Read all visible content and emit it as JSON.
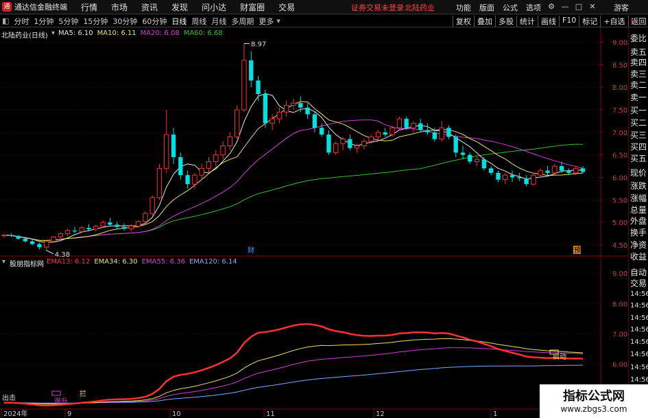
{
  "app": {
    "name": "通达信金融终端",
    "menus": [
      "行情",
      "市场",
      "资讯",
      "发现",
      "问小达",
      "财富圈",
      "交易"
    ],
    "login_status": "证券交易未登录",
    "stock_name": "北陆药业",
    "right_menus": [
      "功能",
      "版面",
      "公式",
      "选项"
    ],
    "guest": "游客",
    "layout_mark": "L"
  },
  "toolbar": {
    "periods": [
      "分时",
      "1分钟",
      "5分钟",
      "15分钟",
      "30分钟",
      "60分钟",
      "日线",
      "周线",
      "月线",
      "多周期",
      "更多"
    ],
    "active_period": "日线",
    "right_buttons": [
      "复权",
      "叠加",
      "多股",
      "统计",
      "画线",
      "F10",
      "标记",
      "+自选",
      "返回"
    ]
  },
  "main_chart": {
    "stock_title": "北陆药业(日线)",
    "ma_legend": [
      {
        "label": "MA5: 6.10",
        "color": "#e6e6e6"
      },
      {
        "label": "MA10: 6.11",
        "color": "#f0e060"
      },
      {
        "label": "MA20: 6.08",
        "color": "#d040d0"
      },
      {
        "label": "MA60: 6.68",
        "color": "#30c030"
      }
    ],
    "y_ticks": [
      "9.00",
      "8.50",
      "8.00",
      "7.50",
      "7.00",
      "6.50",
      "6.00",
      "5.50",
      "5.00",
      "4.50"
    ],
    "high_label": "8.97",
    "low_label": "4.38",
    "marker_cai": "财",
    "marker_yu": "预"
  },
  "indicator": {
    "name": "股朋指标网",
    "legend": [
      {
        "label": "EMA13: 6.12",
        "color": "#ff3030"
      },
      {
        "label": "EMA34: 6.30",
        "color": "#f0e060"
      },
      {
        "label": "EMA55: 6.36",
        "color": "#d040d0"
      },
      {
        "label": "EMA120: 6.14",
        "color": "#80a8ff"
      }
    ],
    "y_ticks": [
      "9.00",
      "8.00",
      "7.00",
      "6.00"
    ],
    "signals": {
      "chu": "出击",
      "qi": "启动",
      "zhang": "涨升",
      "lan": "拦"
    }
  },
  "time_axis": [
    "2024年",
    "9",
    "10",
    "11",
    "12",
    "1"
  ],
  "side_panel": {
    "labels": [
      "委比",
      "卖五",
      "卖四",
      "卖三",
      "卖二",
      "卖一",
      "买一",
      "买二",
      "买三",
      "买四",
      "买五",
      "现价",
      "涨跌",
      "涨幅",
      "总量",
      "外盘",
      "换手",
      "净资",
      "收益",
      "自动",
      "交易"
    ],
    "times": [
      "14:56",
      "14:56",
      "14:56",
      "14:56",
      "14:56",
      "14:56",
      "14:56",
      "14:56"
    ]
  },
  "watermark": {
    "title": "指标公式网",
    "url": "www.zbgs3.com"
  },
  "colors": {
    "up": "#ff3030",
    "down": "#00e0e0",
    "grid": "#4a0000",
    "axis": "#900000"
  },
  "chart_data": {
    "type": "candlestick",
    "title": "北陆药业(日线)",
    "ylim": [
      4.3,
      9.1
    ],
    "ohlc": [
      [
        4.7,
        4.74,
        4.66,
        4.72
      ],
      [
        4.72,
        4.76,
        4.68,
        4.7
      ],
      [
        4.7,
        4.72,
        4.62,
        4.64
      ],
      [
        4.64,
        4.68,
        4.55,
        4.58
      ],
      [
        4.58,
        4.62,
        4.5,
        4.52
      ],
      [
        4.52,
        4.55,
        4.4,
        4.45
      ],
      [
        4.45,
        4.6,
        4.38,
        4.58
      ],
      [
        4.58,
        4.7,
        4.55,
        4.68
      ],
      [
        4.68,
        4.78,
        4.62,
        4.75
      ],
      [
        4.75,
        4.86,
        4.7,
        4.82
      ],
      [
        4.82,
        4.9,
        4.76,
        4.8
      ],
      [
        4.8,
        4.92,
        4.76,
        4.88
      ],
      [
        4.88,
        4.96,
        4.8,
        4.85
      ],
      [
        4.85,
        4.95,
        4.8,
        4.92
      ],
      [
        4.92,
        5.05,
        4.88,
        5.0
      ],
      [
        5.0,
        5.1,
        4.92,
        4.95
      ],
      [
        4.95,
        5.02,
        4.85,
        4.9
      ],
      [
        4.9,
        4.98,
        4.82,
        4.86
      ],
      [
        4.86,
        4.96,
        4.8,
        4.92
      ],
      [
        4.92,
        5.05,
        4.88,
        5.02
      ],
      [
        5.02,
        5.25,
        4.98,
        5.2
      ],
      [
        5.2,
        5.6,
        5.15,
        5.55
      ],
      [
        5.55,
        6.3,
        5.5,
        6.2
      ],
      [
        6.2,
        7.5,
        6.1,
        6.95
      ],
      [
        6.95,
        7.1,
        6.3,
        6.45
      ],
      [
        6.45,
        6.55,
        5.95,
        6.05
      ],
      [
        6.05,
        6.15,
        5.75,
        5.85
      ],
      [
        5.85,
        6.1,
        5.75,
        6.05
      ],
      [
        6.05,
        6.3,
        5.95,
        6.2
      ],
      [
        6.2,
        6.45,
        6.1,
        6.35
      ],
      [
        6.35,
        6.6,
        6.25,
        6.5
      ],
      [
        6.5,
        6.8,
        6.4,
        6.7
      ],
      [
        6.7,
        7.0,
        6.6,
        6.9
      ],
      [
        6.9,
        7.6,
        6.85,
        7.5
      ],
      [
        7.5,
        8.97,
        7.45,
        8.6
      ],
      [
        8.6,
        8.8,
        8.0,
        8.15
      ],
      [
        8.15,
        8.25,
        7.7,
        7.85
      ],
      [
        7.85,
        7.95,
        7.1,
        7.2
      ],
      [
        7.2,
        7.4,
        7.05,
        7.3
      ],
      [
        7.3,
        7.55,
        7.2,
        7.45
      ],
      [
        7.45,
        7.7,
        7.35,
        7.6
      ],
      [
        7.6,
        7.75,
        7.5,
        7.65
      ],
      [
        7.65,
        7.8,
        7.45,
        7.55
      ],
      [
        7.55,
        7.65,
        7.3,
        7.4
      ],
      [
        7.4,
        7.45,
        7.0,
        7.1
      ],
      [
        7.1,
        7.2,
        6.9,
        6.95
      ],
      [
        6.95,
        7.05,
        6.5,
        6.55
      ],
      [
        6.55,
        6.8,
        6.5,
        6.75
      ],
      [
        6.75,
        6.9,
        6.6,
        6.85
      ],
      [
        6.85,
        6.95,
        6.6,
        6.65
      ],
      [
        6.65,
        6.75,
        6.55,
        6.7
      ],
      [
        6.7,
        6.85,
        6.62,
        6.8
      ],
      [
        6.8,
        6.95,
        6.75,
        6.9
      ],
      [
        6.9,
        7.05,
        6.8,
        7.0
      ],
      [
        7.0,
        7.1,
        6.9,
        6.95
      ],
      [
        6.95,
        7.15,
        6.9,
        7.1
      ],
      [
        7.1,
        7.35,
        7.05,
        7.3
      ],
      [
        7.3,
        7.35,
        7.05,
        7.1
      ],
      [
        7.1,
        7.25,
        7.0,
        7.2
      ],
      [
        7.2,
        7.3,
        7.0,
        7.05
      ],
      [
        7.05,
        7.2,
        6.95,
        7.0
      ],
      [
        7.0,
        7.1,
        6.8,
        6.85
      ],
      [
        6.85,
        7.25,
        6.8,
        7.1
      ],
      [
        7.1,
        7.15,
        6.85,
        6.9
      ],
      [
        6.9,
        6.95,
        6.45,
        6.55
      ],
      [
        6.55,
        6.7,
        6.4,
        6.5
      ],
      [
        6.5,
        6.55,
        6.3,
        6.35
      ],
      [
        6.35,
        6.45,
        6.25,
        6.4
      ],
      [
        6.4,
        6.45,
        6.15,
        6.2
      ],
      [
        6.2,
        6.25,
        6.05,
        6.1
      ],
      [
        6.1,
        6.15,
        5.9,
        5.95
      ],
      [
        5.95,
        6.1,
        5.85,
        6.05
      ],
      [
        6.05,
        6.15,
        5.9,
        6.0
      ],
      [
        6.0,
        6.1,
        5.92,
        5.98
      ],
      [
        5.98,
        6.05,
        5.8,
        5.85
      ],
      [
        5.85,
        6.1,
        5.82,
        6.05
      ],
      [
        6.05,
        6.2,
        6.0,
        6.15
      ],
      [
        6.15,
        6.25,
        6.05,
        6.1
      ],
      [
        6.1,
        6.3,
        6.05,
        6.25
      ],
      [
        6.25,
        6.35,
        6.1,
        6.15
      ],
      [
        6.15,
        6.2,
        6.05,
        6.1
      ],
      [
        6.1,
        6.25,
        6.05,
        6.2
      ],
      [
        6.2,
        6.25,
        6.08,
        6.12
      ]
    ],
    "ma_values": {
      "MA5": 6.1,
      "MA10": 6.11,
      "MA20": 6.08,
      "MA60": 6.68
    },
    "ema_values": {
      "EMA13": 6.12,
      "EMA34": 6.3,
      "EMA55": 6.36,
      "EMA120": 6.14
    }
  }
}
